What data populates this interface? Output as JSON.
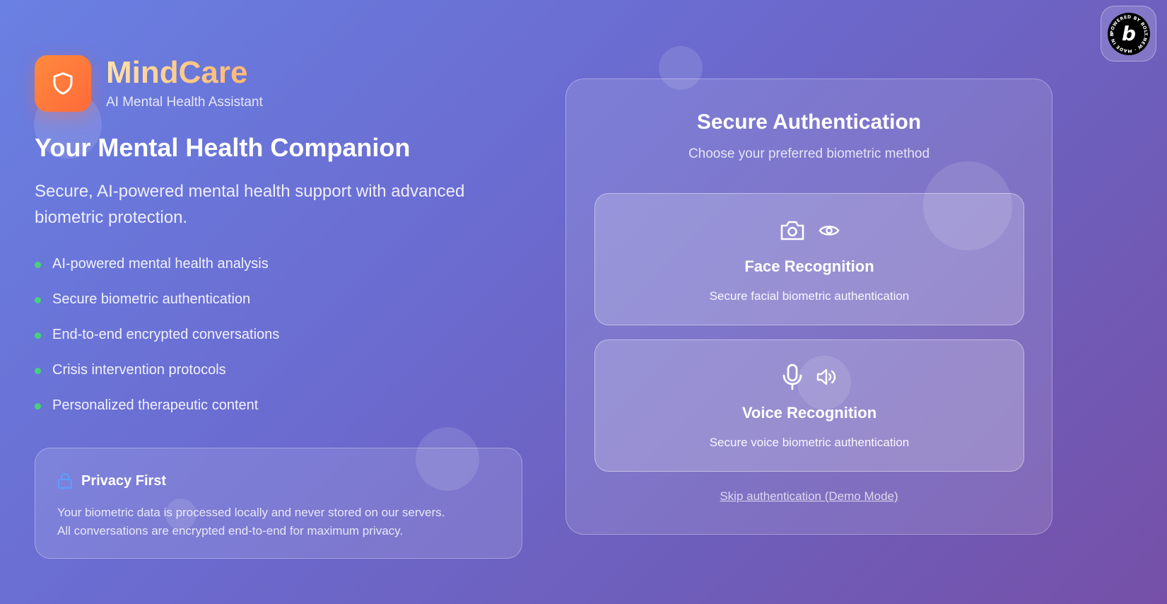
{
  "brand": {
    "name": "MindCare",
    "tagline": "AI Mental Health Assistant",
    "logo_icon": "shield-icon"
  },
  "hero": {
    "title": "Your Mental Health Companion",
    "description": "Secure, AI-powered mental health support with advanced biometric protection."
  },
  "features": [
    "AI-powered mental health analysis",
    "Secure biometric authentication",
    "End-to-end encrypted conversations",
    "Crisis intervention protocols",
    "Personalized therapeutic content"
  ],
  "privacy": {
    "title": "Privacy First",
    "icon": "lock-icon",
    "line1": "Your biometric data is processed locally and never stored on our servers.",
    "line2": "All conversations are encrypted end-to-end for maximum privacy."
  },
  "auth": {
    "title": "Secure Authentication",
    "subtitle": "Choose your preferred biometric method",
    "methods": [
      {
        "title": "Face Recognition",
        "description": "Secure facial biometric authentication",
        "icons": [
          "camera-icon",
          "eye-icon"
        ]
      },
      {
        "title": "Voice Recognition",
        "description": "Secure voice biometric authentication",
        "icons": [
          "microphone-icon",
          "speaker-icon"
        ]
      }
    ],
    "skip_label": "Skip authentication (Demo Mode)"
  },
  "badge": {
    "ring_text": "POWERED BY BOLT.NEW · MADE IN BOLT.NEW ·",
    "letter": "b"
  },
  "colors": {
    "bullet": "#45d27a",
    "logo_gradient_start": "#ff8a3d",
    "logo_gradient_end": "#ff6a3a",
    "brand_text_start": "#ffe2a8",
    "brand_text_end": "#ffb36b",
    "lock_icon": "#5aa0ff"
  }
}
